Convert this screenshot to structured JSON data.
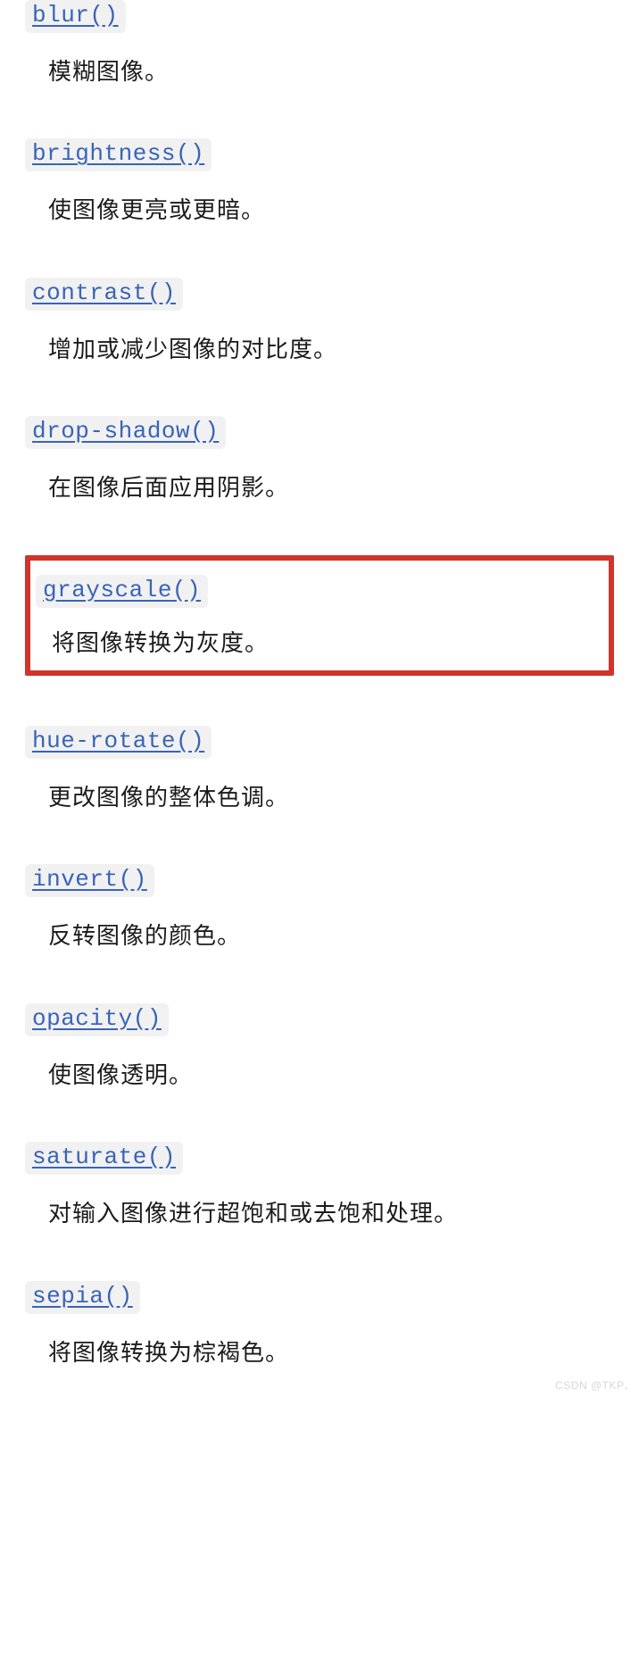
{
  "items": [
    {
      "name": "blur()",
      "desc": "模糊图像。",
      "highlighted": false
    },
    {
      "name": "brightness()",
      "desc": "使图像更亮或更暗。",
      "highlighted": false
    },
    {
      "name": "contrast()",
      "desc": "增加或减少图像的对比度。",
      "highlighted": false
    },
    {
      "name": "drop-shadow()",
      "desc": "在图像后面应用阴影。",
      "highlighted": false
    },
    {
      "name": "grayscale()",
      "desc": "将图像转换为灰度。",
      "highlighted": true
    },
    {
      "name": "hue-rotate()",
      "desc": "更改图像的整体色调。",
      "highlighted": false
    },
    {
      "name": "invert()",
      "desc": "反转图像的颜色。",
      "highlighted": false
    },
    {
      "name": "opacity()",
      "desc": "使图像透明。",
      "highlighted": false
    },
    {
      "name": "saturate()",
      "desc": "对输入图像进行超饱和或去饱和处理。",
      "highlighted": false
    },
    {
      "name": "sepia()",
      "desc": "将图像转换为棕褐色。",
      "highlighted": false
    }
  ],
  "watermark": "CSDN @TKP、"
}
